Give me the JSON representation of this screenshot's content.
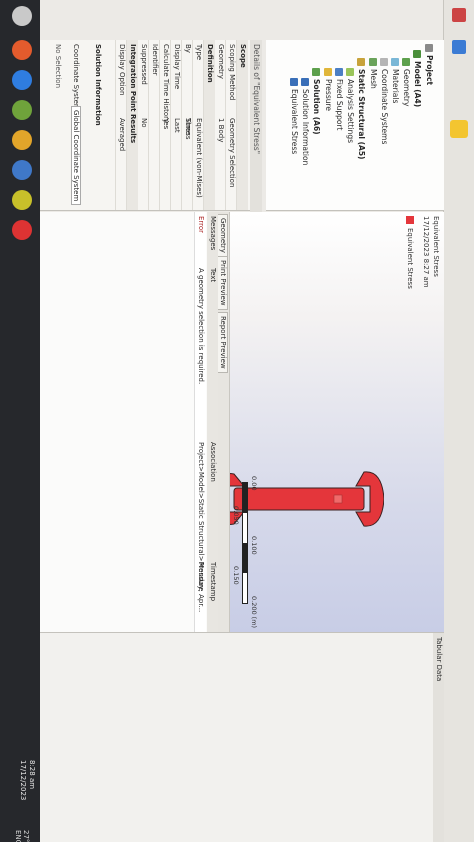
{
  "taskbar": {
    "time": "8:28 am",
    "date": "17/12/2023",
    "temp": "27°C",
    "lang": "ENG"
  },
  "outline": {
    "project": "Project",
    "model": "Model (A4)",
    "items": [
      "Geometry",
      "Materials",
      "Coordinate Systems",
      "Mesh"
    ],
    "analysis": "Static Structural (A5)",
    "analysis_items": [
      "Analysis Settings",
      "Fixed Support",
      "Pressure"
    ],
    "solution": "Solution (A6)",
    "solution_items": [
      "Solution Information",
      "Equivalent Stress"
    ]
  },
  "details": {
    "title": "Details of \"Equivalent Stress\"",
    "rows": [
      {
        "k": "Scope",
        "v": "",
        "section": true
      },
      {
        "k": "Scoping Method",
        "v": "Geometry Selection",
        "section": false
      },
      {
        "k": "Geometry",
        "v": "1 Body",
        "section": false
      },
      {
        "k": "Definition",
        "v": "",
        "section": true
      },
      {
        "k": "Type",
        "v": "Equivalent (von-Mises) Stress",
        "section": false
      },
      {
        "k": "By",
        "v": "Time",
        "section": false
      },
      {
        "k": "Display Time",
        "v": "Last",
        "section": false
      },
      {
        "k": "Calculate Time History",
        "v": "Yes",
        "section": false
      },
      {
        "k": "Identifier",
        "v": "",
        "section": false
      },
      {
        "k": "Suppressed",
        "v": "No",
        "section": false
      },
      {
        "k": "Integration Point Results",
        "v": "",
        "section": true
      },
      {
        "k": "Display Option",
        "v": "Averaged",
        "section": false
      }
    ],
    "extra": "Solution Information"
  },
  "viewport": {
    "result_title": "Equivalent Stress",
    "timestamp": "17/12/2023 8:27 am",
    "legend_label": "Equivalent Stress"
  },
  "tabs": [
    "Geometry",
    "Print Preview",
    "Report Preview"
  ],
  "coord_label": "Coordinate Systems",
  "coord_value": "Global Coordinate System",
  "no_selection": "No Selection",
  "messages": {
    "title": "Messages",
    "columns": [
      "Text",
      "Association"
    ],
    "rows": [
      {
        "type": "Error",
        "text": "A geometry selection is required.",
        "assoc": "Project>Model>Static Structural>Pressure"
      }
    ],
    "extra_cols": [
      "Timestamp",
      "Monday, Apr..."
    ]
  },
  "graph": {
    "title": "Tabular Data",
    "ticks": [
      "0.00",
      "0.050",
      "0.100",
      "0.150",
      "0.200 (m)"
    ]
  },
  "colors": {
    "wrench": "#e4363b",
    "taskbar": "#26282c"
  }
}
